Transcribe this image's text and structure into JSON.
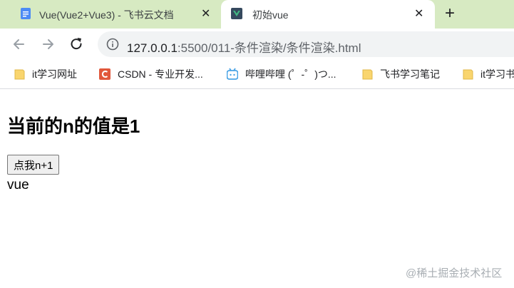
{
  "browser": {
    "tabs": [
      {
        "title": "Vue(Vue2+Vue3) - 飞书云文档",
        "close": "✕",
        "active": false,
        "favicon": "doc-icon"
      },
      {
        "title": "初始vue",
        "close": "✕",
        "active": true,
        "favicon": "vue-page-icon"
      }
    ],
    "new_tab": "+",
    "address": {
      "host": "127.0.0.1",
      "rest": ":5500/011-条件渲染/条件渲染.html"
    },
    "bookmarks": [
      {
        "label": "it学习网址",
        "icon": "folder-icon",
        "color": "#f9d56e"
      },
      {
        "label": "CSDN - 专业开发...",
        "icon": "csdn-icon",
        "color": "#e1573b"
      },
      {
        "label": "哔哩哔哩 (゜-゜)つ...",
        "icon": "bilibili-icon",
        "color": "#4aa4e6"
      },
      {
        "label": "飞书学习笔记",
        "icon": "folder-icon",
        "color": "#f9d56e"
      },
      {
        "label": "it学习书",
        "icon": "folder-icon",
        "color": "#f9d56e"
      }
    ]
  },
  "page": {
    "heading": "当前的n的值是1",
    "button_label": "点我n+1",
    "vue_text": "vue"
  },
  "watermark": "@稀土掘金技术社区"
}
